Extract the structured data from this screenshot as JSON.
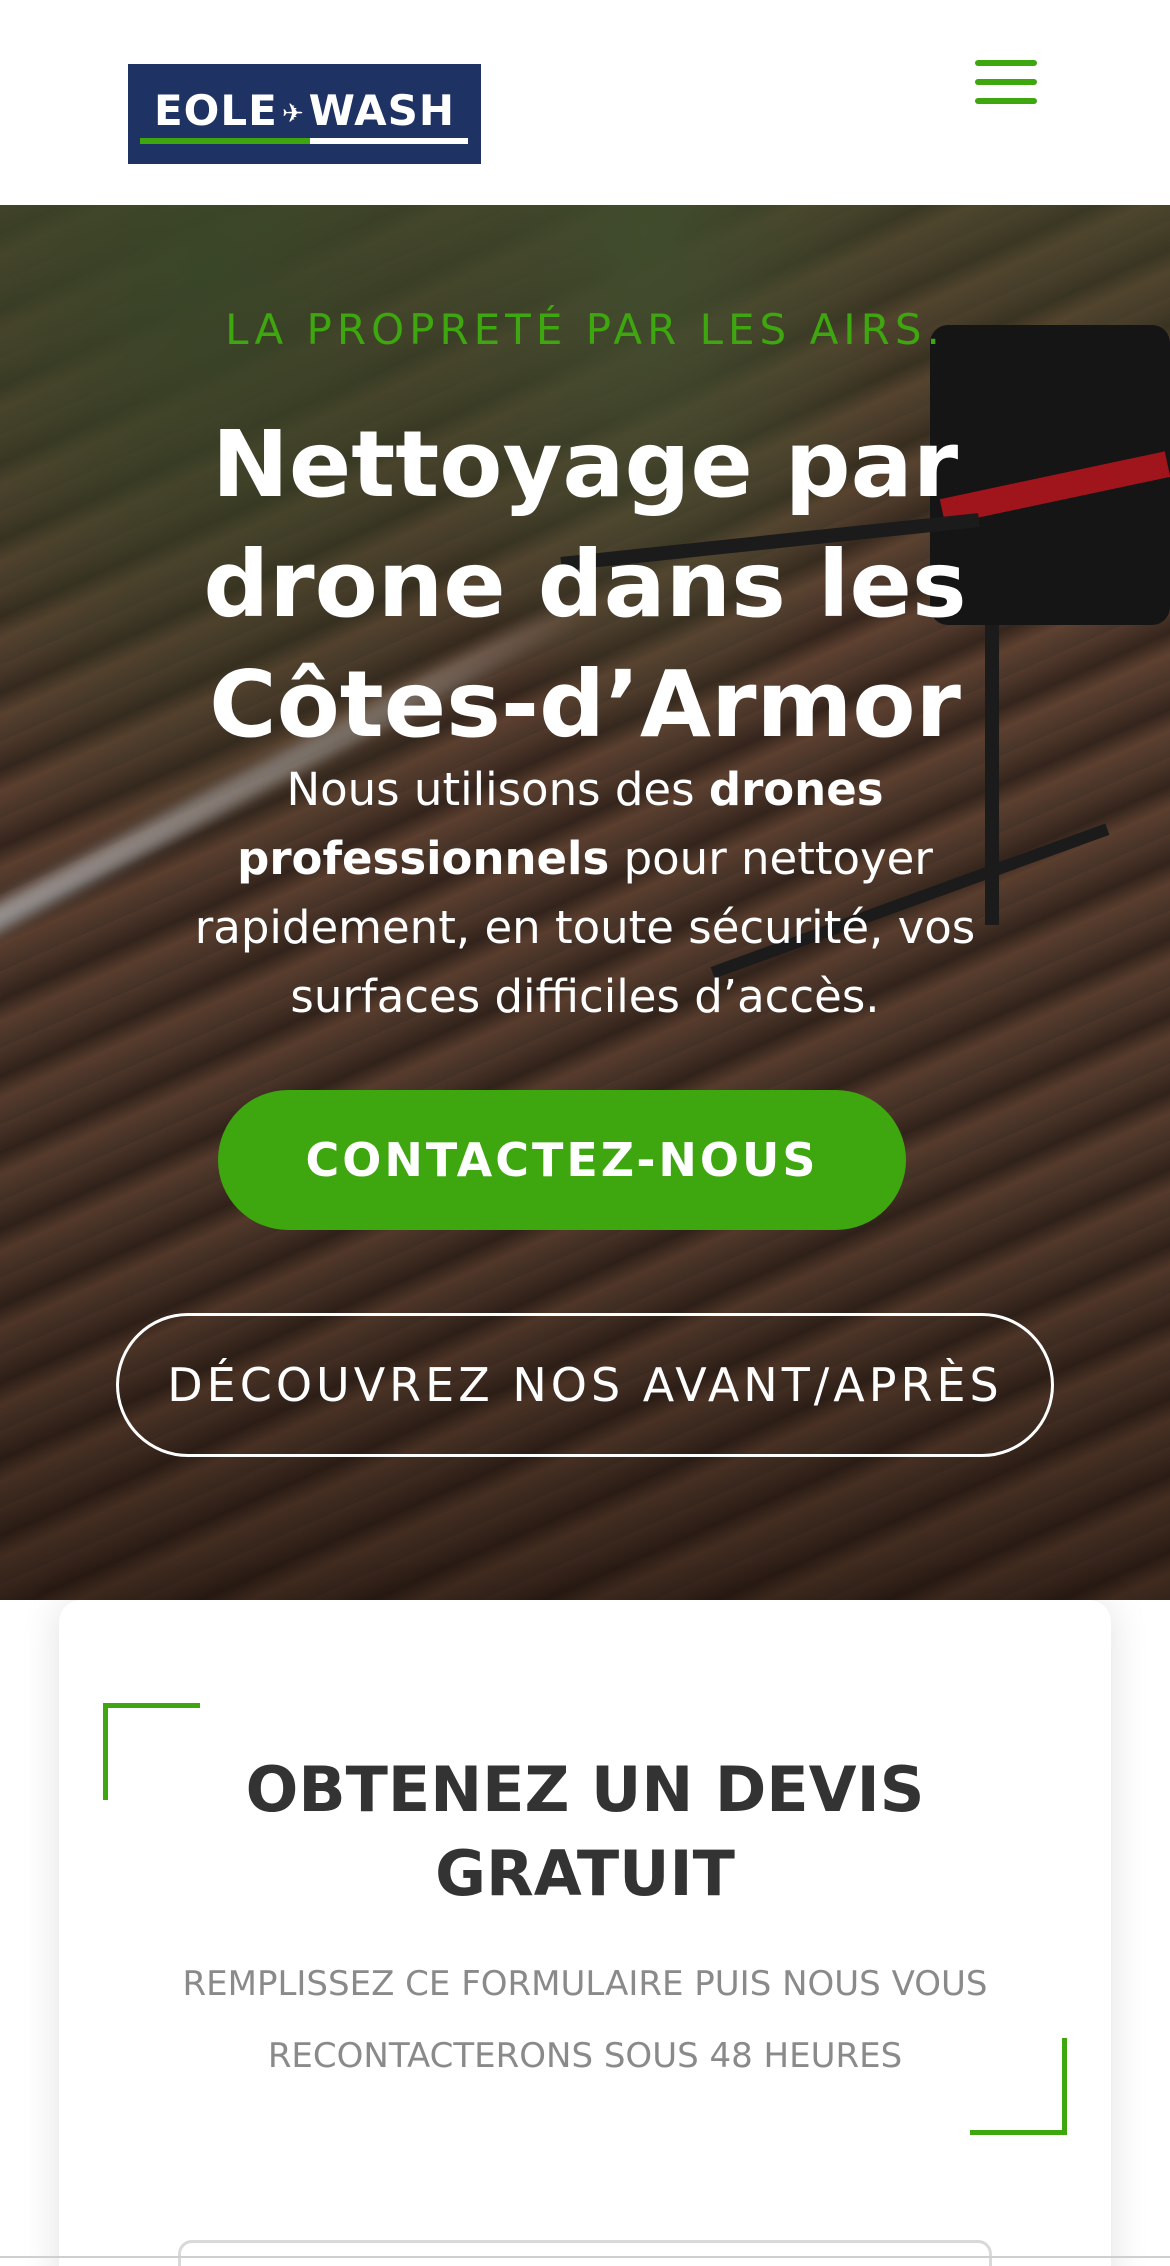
{
  "header": {
    "logo_text_left": "EOLE",
    "logo_text_right": "WASH",
    "logo_drone_icon": "drone-icon",
    "menu_icon": "hamburger-menu-icon"
  },
  "hero": {
    "kicker": "LA PROPRETÉ PAR LES AIRS.",
    "title": "Nettoyage par drone dans les Côtes-d’Armor",
    "text_part1": "Nous utilisons des ",
    "text_bold": "drones professionnels",
    "text_part2": " pour nettoyer rapidement, en toute sécurité, vos surfaces difficiles d’accès.",
    "contact_button": "CONTACTEZ-NOUS",
    "avant_apres_button": "DÉCOUVREZ NOS AVANT/APRÈS"
  },
  "quote_card": {
    "title": "OBTENEZ UN DEVIS GRATUIT",
    "subtitle": "REMPLISSEZ CE FORMULAIRE PUIS NOUS VOUS RECONTACTERONS SOUS 48 HEURES"
  },
  "colors": {
    "accent_green": "#3ea60f",
    "logo_navy": "#1e3263",
    "title_dark": "#333333",
    "subtitle_gray": "#8a8a8a"
  }
}
